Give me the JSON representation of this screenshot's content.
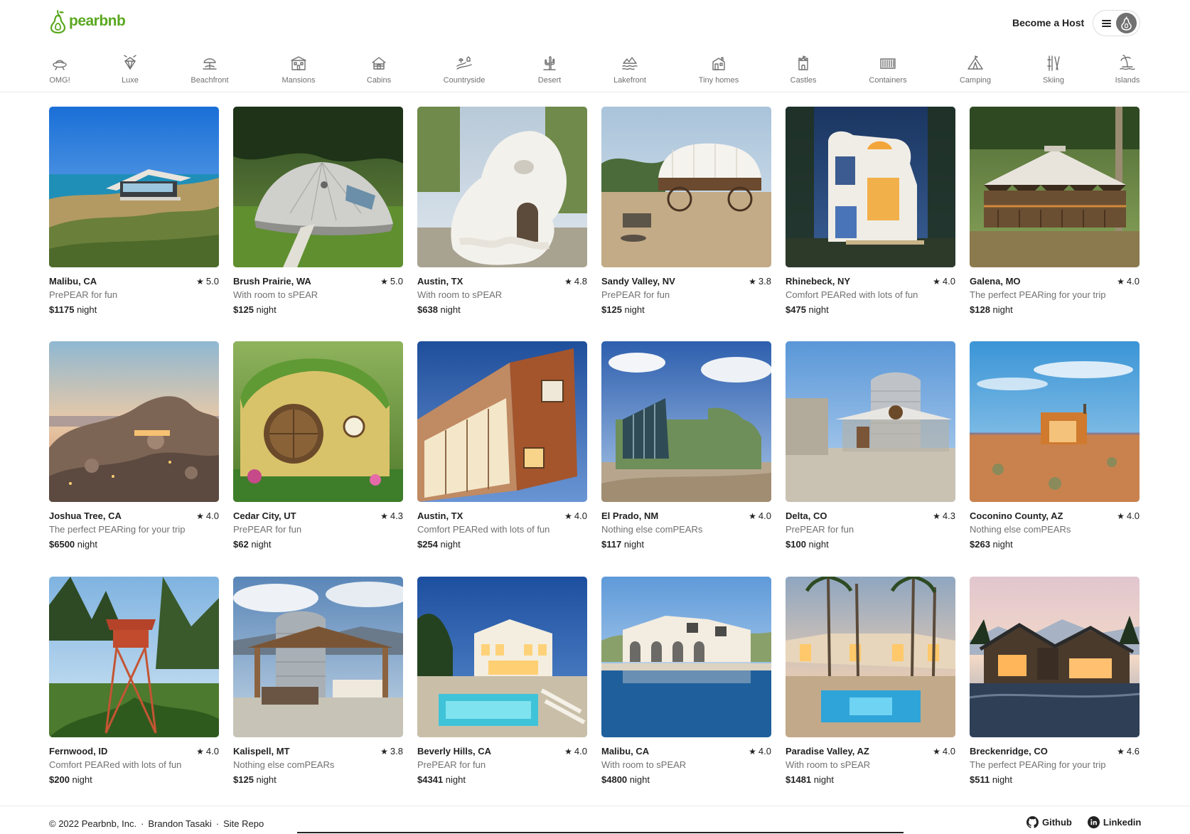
{
  "header": {
    "logo_text": "pearbnb",
    "brand_color": "#5aa81f",
    "become_host": "Become a Host"
  },
  "categories": [
    {
      "label": "OMG!",
      "icon": "ufo-icon"
    },
    {
      "label": "Luxe",
      "icon": "diamond-icon"
    },
    {
      "label": "Beachfront",
      "icon": "beach-umbrella-icon"
    },
    {
      "label": "Mansions",
      "icon": "mansion-icon"
    },
    {
      "label": "Cabins",
      "icon": "cabin-icon"
    },
    {
      "label": "Countryside",
      "icon": "countryside-icon"
    },
    {
      "label": "Desert",
      "icon": "cactus-icon"
    },
    {
      "label": "Lakefront",
      "icon": "lakefront-icon"
    },
    {
      "label": "Tiny homes",
      "icon": "tiny-home-icon"
    },
    {
      "label": "Castles",
      "icon": "castle-icon"
    },
    {
      "label": "Containers",
      "icon": "container-icon"
    },
    {
      "label": "Camping",
      "icon": "tent-icon"
    },
    {
      "label": "Skiing",
      "icon": "ski-icon"
    },
    {
      "label": "Islands",
      "icon": "island-icon"
    }
  ],
  "listings": [
    {
      "location": "Malibu, CA",
      "rating": "5.0",
      "tagline": "PrePEAR for fun",
      "price": "$1175",
      "unit": "night",
      "theme": "coast-house"
    },
    {
      "location": "Brush Prairie, WA",
      "rating": "5.0",
      "tagline": "With room to sPEAR",
      "price": "$125",
      "unit": "night",
      "theme": "dome-house"
    },
    {
      "location": "Austin, TX",
      "rating": "4.8",
      "tagline": "With room to sPEAR",
      "price": "$638",
      "unit": "night",
      "theme": "white-sculpture"
    },
    {
      "location": "Sandy Valley, NV",
      "rating": "3.8",
      "tagline": "PrePEAR for fun",
      "price": "$125",
      "unit": "night",
      "theme": "covered-wagon"
    },
    {
      "location": "Rhinebeck, NY",
      "rating": "4.0",
      "tagline": "Comfort PEARed with lots of fun",
      "price": "$475",
      "unit": "night",
      "theme": "modern-night"
    },
    {
      "location": "Galena, MO",
      "rating": "4.0",
      "tagline": "The perfect PEARing for your trip",
      "price": "$128",
      "unit": "night",
      "theme": "yurt"
    },
    {
      "location": "Joshua Tree, CA",
      "rating": "4.0",
      "tagline": "The perfect PEARing for your trip",
      "price": "$6500",
      "unit": "night",
      "theme": "desert-rocks"
    },
    {
      "location": "Cedar City, UT",
      "rating": "4.3",
      "tagline": "PrePEAR for fun",
      "price": "$62",
      "unit": "night",
      "theme": "hobbit-house"
    },
    {
      "location": "Austin, TX",
      "rating": "4.0",
      "tagline": "Comfort PEARed with lots of fun",
      "price": "$254",
      "unit": "night",
      "theme": "shingle-house"
    },
    {
      "location": "El Prado, NM",
      "rating": "4.0",
      "tagline": "Nothing else comPEARs",
      "price": "$117",
      "unit": "night",
      "theme": "earthship"
    },
    {
      "location": "Delta, CO",
      "rating": "4.3",
      "tagline": "PrePEAR for fun",
      "price": "$100",
      "unit": "night",
      "theme": "silo-home"
    },
    {
      "location": "Coconino County, AZ",
      "rating": "4.0",
      "tagline": "Nothing else comPEARs",
      "price": "$263",
      "unit": "night",
      "theme": "desert-cabin"
    },
    {
      "location": "Fernwood, ID",
      "rating": "4.0",
      "tagline": "Comfort PEARed with lots of fun",
      "price": "$200",
      "unit": "night",
      "theme": "fire-tower"
    },
    {
      "location": "Kalispell, MT",
      "rating": "3.8",
      "tagline": "Nothing else comPEARs",
      "price": "$125",
      "unit": "night",
      "theme": "grain-silo"
    },
    {
      "location": "Beverly Hills, CA",
      "rating": "4.0",
      "tagline": "PrePEAR for fun",
      "price": "$4341",
      "unit": "night",
      "theme": "pool-villa-dusk"
    },
    {
      "location": "Malibu, CA",
      "rating": "4.0",
      "tagline": "With room to sPEAR",
      "price": "$4800",
      "unit": "night",
      "theme": "pool-villa-day"
    },
    {
      "location": "Paradise Valley, AZ",
      "rating": "4.0",
      "tagline": "With room to sPEAR",
      "price": "$1481",
      "unit": "night",
      "theme": "palm-pool"
    },
    {
      "location": "Breckenridge, CO",
      "rating": "4.6",
      "tagline": "The perfect PEARing for your trip",
      "price": "$511",
      "unit": "night",
      "theme": "mountain-lodge"
    }
  ],
  "footer": {
    "copyright": "© 2022 Pearbnb, Inc.",
    "author": "Brandon Tasaki",
    "repo": "Site Repo",
    "separator": "·",
    "github": "Github",
    "linkedin": "Linkedin"
  }
}
